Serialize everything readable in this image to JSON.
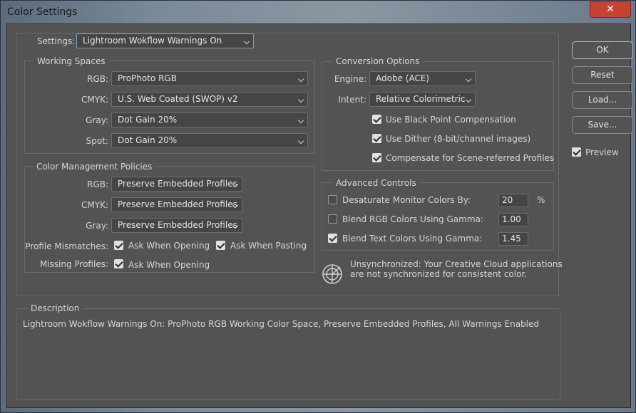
{
  "window": {
    "title": "Color Settings",
    "close_glyph": "✕"
  },
  "settings": {
    "label": "Settings:",
    "value": "Lightroom Wokflow Warnings On"
  },
  "working_spaces": {
    "title": "Working Spaces",
    "rgb_label": "RGB:",
    "rgb_value": "ProPhoto RGB",
    "cmyk_label": "CMYK:",
    "cmyk_value": "U.S. Web Coated (SWOP) v2",
    "gray_label": "Gray:",
    "gray_value": "Dot Gain 20%",
    "spot_label": "Spot:",
    "spot_value": "Dot Gain 20%"
  },
  "policies": {
    "title": "Color Management Policies",
    "rgb_label": "RGB:",
    "rgb_value": "Preserve Embedded Profiles",
    "cmyk_label": "CMYK:",
    "cmyk_value": "Preserve Embedded Profiles",
    "gray_label": "Gray:",
    "gray_value": "Preserve Embedded Profiles",
    "mismatch_label": "Profile Mismatches:",
    "ask_opening": "Ask When Opening",
    "ask_pasting": "Ask When Pasting",
    "missing_label": "Missing Profiles:",
    "missing_ask_opening": "Ask When Opening"
  },
  "conversion": {
    "title": "Conversion Options",
    "engine_label": "Engine:",
    "engine_value": "Adobe (ACE)",
    "intent_label": "Intent:",
    "intent_value": "Relative Colorimetric",
    "bpc": "Use Black Point Compensation",
    "dither": "Use Dither (8-bit/channel images)",
    "scene": "Compensate for Scene-referred Profiles"
  },
  "advanced": {
    "title": "Advanced Controls",
    "desaturate": "Desaturate Monitor Colors By:",
    "desaturate_value": "20",
    "desaturate_unit": "%",
    "blend_rgb": "Blend RGB Colors Using Gamma:",
    "blend_rgb_value": "1.00",
    "blend_text": "Blend Text Colors Using Gamma:",
    "blend_text_value": "1.45"
  },
  "sync": {
    "line1": "Unsynchronized: Your Creative Cloud applications",
    "line2": "are not synchronized for consistent color.",
    "icon": "sync-status-icon"
  },
  "buttons": {
    "ok": "OK",
    "reset": "Reset",
    "load": "Load...",
    "save": "Save...",
    "preview": "Preview"
  },
  "description": {
    "title": "Description",
    "text": "Lightroom Wokflow Warnings On:  ProPhoto RGB Working Color Space, Preserve Embedded Profiles, All Warnings Enabled"
  }
}
